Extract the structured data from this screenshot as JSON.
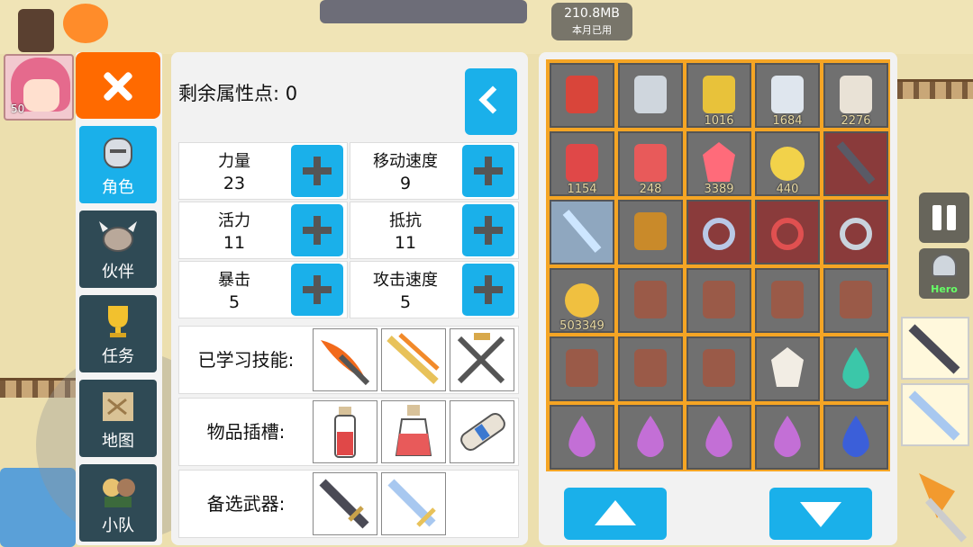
{
  "status": {
    "memory": "210.8MB",
    "memory_label": "本月已用"
  },
  "player": {
    "level": "50"
  },
  "tabs": [
    {
      "label": "角色",
      "icon": "knight-helmet-icon",
      "active": true
    },
    {
      "label": "伙伴",
      "icon": "viking-helmet-icon",
      "active": false
    },
    {
      "label": "任务",
      "icon": "trophy-icon",
      "active": false
    },
    {
      "label": "地图",
      "icon": "map-scroll-icon",
      "active": false
    },
    {
      "label": "小队",
      "icon": "party-icon",
      "active": false
    }
  ],
  "attributes": {
    "remaining_label": "剩余属性点: 0",
    "stats": [
      {
        "name": "力量",
        "value": "23"
      },
      {
        "name": "移动速度",
        "value": "9"
      },
      {
        "name": "活力",
        "value": "11"
      },
      {
        "name": "抵抗",
        "value": "11"
      },
      {
        "name": "暴击",
        "value": "5"
      },
      {
        "name": "攻击速度",
        "value": "5"
      }
    ],
    "learned_skills_label": "已学习技能:",
    "item_slots_label": "物品插槽:",
    "backup_weapons_label": "备选武器:",
    "skills": [
      "fire-claw-icon",
      "flame-sword-icon",
      "swords-icon"
    ],
    "item_slots": [
      "red-potion-small-icon",
      "red-potion-large-icon",
      "scroll-icon"
    ],
    "backup_weapons": [
      "dark-sword-icon",
      "crystal-sword-icon"
    ]
  },
  "hud": {
    "hero_label": "Hero"
  },
  "inventory": {
    "rows": [
      [
        {
          "icon": "fire-scroll-icon",
          "count": "",
          "style": "normal",
          "color": "#d9453a"
        },
        {
          "icon": "drill-icon",
          "count": "",
          "style": "normal",
          "color": "#cfd6dd"
        },
        {
          "icon": "key-icon",
          "count": "1016",
          "style": "normal",
          "color": "#e8c23a"
        },
        {
          "icon": "blue-scroll-icon",
          "count": "1684",
          "style": "normal",
          "color": "#dfe6ee"
        },
        {
          "icon": "red-scroll-icon",
          "count": "2276",
          "style": "normal",
          "color": "#e9e2d6"
        }
      ],
      [
        {
          "icon": "red-potion-icon",
          "count": "1154",
          "style": "normal",
          "color": "#e04848"
        },
        {
          "icon": "red-flask-icon",
          "count": "248",
          "style": "normal",
          "color": "#e85a5a"
        },
        {
          "icon": "ruby-icon",
          "count": "3389",
          "style": "normal",
          "color": "#ff6b7a"
        },
        {
          "icon": "gold-orb-icon",
          "count": "440",
          "style": "normal",
          "color": "#f2d24a"
        },
        {
          "icon": "dark-sword-icon",
          "count": "",
          "style": "red",
          "color": "#5a5a66"
        }
      ],
      [
        {
          "icon": "crystal-sword-icon",
          "count": "",
          "style": "blue",
          "color": "#cde6ff"
        },
        {
          "icon": "golden-armor-icon",
          "count": "",
          "style": "normal",
          "color": "#c98a2a"
        },
        {
          "icon": "diamond-ring-icon",
          "count": "",
          "style": "red",
          "color": "#b9c8e6"
        },
        {
          "icon": "ruby-ring-icon",
          "count": "",
          "style": "red",
          "color": "#e05050"
        },
        {
          "icon": "pendant-icon",
          "count": "",
          "style": "red",
          "color": "#c9d3dd"
        }
      ],
      [
        {
          "icon": "gold-coins-icon",
          "count": "503349",
          "style": "normal",
          "color": "#f0c040"
        },
        {
          "icon": "spell-book-icon",
          "count": "",
          "style": "normal",
          "color": "#9a5a48"
        },
        {
          "icon": "spell-book-icon",
          "count": "",
          "style": "normal",
          "color": "#9a5a48"
        },
        {
          "icon": "spell-book-icon",
          "count": "",
          "style": "normal",
          "color": "#9a5a48"
        },
        {
          "icon": "spell-book-icon",
          "count": "",
          "style": "normal",
          "color": "#9a5a48"
        }
      ],
      [
        {
          "icon": "spell-book-icon",
          "count": "",
          "style": "normal",
          "color": "#9a5a48"
        },
        {
          "icon": "spell-book-icon",
          "count": "",
          "style": "normal",
          "color": "#9a5a48"
        },
        {
          "icon": "spell-book-icon",
          "count": "",
          "style": "normal",
          "color": "#9a5a48"
        },
        {
          "icon": "white-gem-icon",
          "count": "",
          "style": "normal",
          "color": "#f2ede4"
        },
        {
          "icon": "teal-drop-icon",
          "count": "",
          "style": "normal",
          "color": "#3bc7a9"
        }
      ],
      [
        {
          "icon": "purple-drop-icon",
          "count": "",
          "style": "normal",
          "color": "#c36fd6"
        },
        {
          "icon": "purple-drop-icon",
          "count": "",
          "style": "normal",
          "color": "#c36fd6"
        },
        {
          "icon": "purple-drop-icon",
          "count": "",
          "style": "normal",
          "color": "#c36fd6"
        },
        {
          "icon": "purple-drop-icon",
          "count": "",
          "style": "normal",
          "color": "#c36fd6"
        },
        {
          "icon": "blue-drop-icon",
          "count": "",
          "style": "normal",
          "color": "#3b5fd9"
        }
      ]
    ]
  }
}
